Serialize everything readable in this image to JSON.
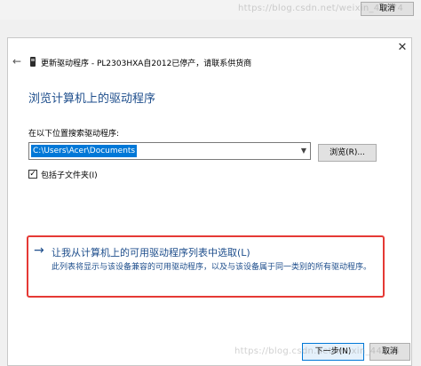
{
  "watermark": {
    "top": "https://blog.csdn.net/weixin_44074",
    "bottom": "https://blog.csdn.net/weixin_44074"
  },
  "background_window": {
    "cancel_label": "取消"
  },
  "dialog": {
    "close_icon": "close-icon",
    "back_icon": "back-arrow-icon",
    "device_icon": "usb-device-icon",
    "header_title": "更新驱动程序 - PL2303HXA自2012已停产，请联系供货商",
    "heading": "浏览计算机上的驱动程序",
    "search_label": "在以下位置搜索驱动程序:",
    "path_value": "C:\\Users\\Acer\\Documents",
    "browse_label": "浏览(R)...",
    "include_subfolders_checked": true,
    "include_subfolders_label": "包括子文件夹(I)",
    "pick_arrow": "→",
    "pick_title": "让我从计算机上的可用驱动程序列表中选取(L)",
    "pick_description": "此列表将显示与该设备兼容的可用驱动程序，以及与该设备属于同一类别的所有驱动程序。",
    "next_label": "下一步(N)",
    "cancel_label": "取消"
  },
  "colors": {
    "accent_blue": "#1e4e8c",
    "selection_blue": "#0078d7",
    "highlight_red": "#e53935"
  }
}
